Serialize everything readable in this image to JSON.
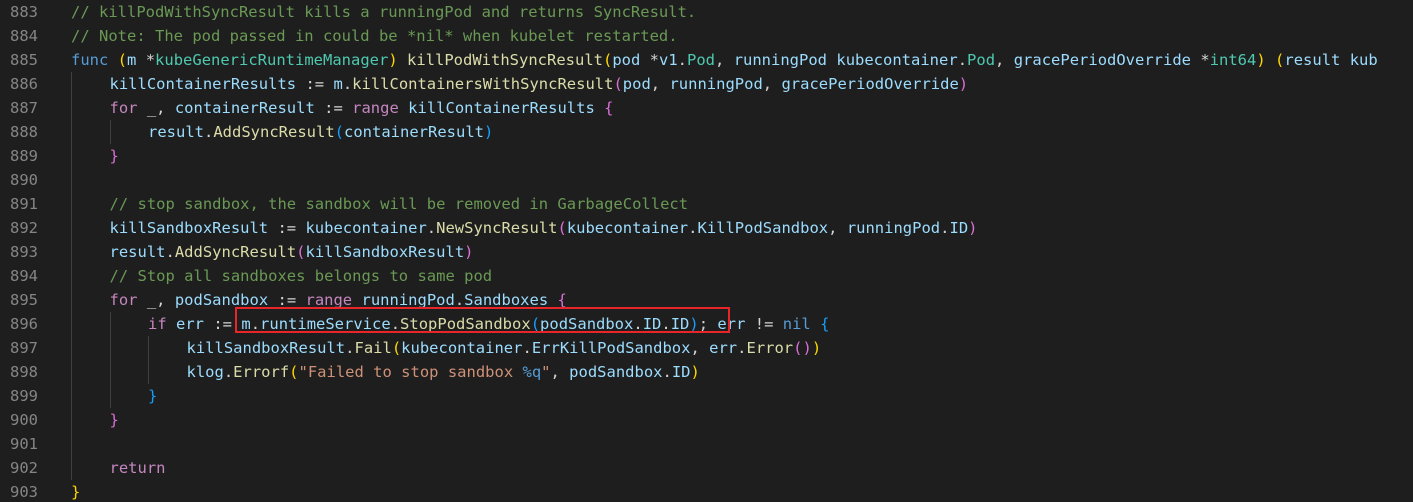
{
  "editor": {
    "language": "go",
    "background": "#1e1e1e",
    "colors": {
      "comment": "#6a9955",
      "keyword": "#569cd6",
      "control": "#c586c0",
      "function": "#dcdcaa",
      "variable": "#9cdcfe",
      "type": "#4ec9b0",
      "string": "#ce9178",
      "bracket_level_1": "#ffd700",
      "bracket_level_2": "#da70d6",
      "bracket_level_3": "#179fff",
      "line_number": "#858585",
      "highlight_box": "#e8262a"
    },
    "highlighted_line": 896,
    "highlighted_text": "m.runtimeService.StopPodSandbox(podSandbox.ID.ID);",
    "lines": [
      {
        "num": "883",
        "indent": 0,
        "tokens": [
          {
            "t": "// killPodWithSyncResult kills a runningPod and returns SyncResult.",
            "c": "cm"
          }
        ]
      },
      {
        "num": "884",
        "indent": 0,
        "tokens": [
          {
            "t": "// Note: The pod passed in could be *nil* when kubelet restarted.",
            "c": "cm"
          }
        ]
      },
      {
        "num": "885",
        "indent": 0,
        "tokens": [
          {
            "t": "func",
            "c": "kw"
          },
          {
            "t": " ",
            "c": "pl"
          },
          {
            "t": "(",
            "c": "b1"
          },
          {
            "t": "m",
            "c": "vr"
          },
          {
            "t": " *",
            "c": "pl"
          },
          {
            "t": "kubeGenericRuntimeManager",
            "c": "ty"
          },
          {
            "t": ")",
            "c": "b1"
          },
          {
            "t": " ",
            "c": "pl"
          },
          {
            "t": "killPodWithSyncResult",
            "c": "fn"
          },
          {
            "t": "(",
            "c": "b1"
          },
          {
            "t": "pod",
            "c": "vr"
          },
          {
            "t": " *",
            "c": "pl"
          },
          {
            "t": "v1",
            "c": "vr"
          },
          {
            "t": ".",
            "c": "pl"
          },
          {
            "t": "Pod",
            "c": "ty"
          },
          {
            "t": ", ",
            "c": "pl"
          },
          {
            "t": "runningPod",
            "c": "vr"
          },
          {
            "t": " ",
            "c": "pl"
          },
          {
            "t": "kubecontainer",
            "c": "vr"
          },
          {
            "t": ".",
            "c": "pl"
          },
          {
            "t": "Pod",
            "c": "ty"
          },
          {
            "t": ", ",
            "c": "pl"
          },
          {
            "t": "gracePeriodOverride",
            "c": "vr"
          },
          {
            "t": " *",
            "c": "pl"
          },
          {
            "t": "int64",
            "c": "ty"
          },
          {
            "t": ")",
            "c": "b1"
          },
          {
            "t": " ",
            "c": "pl"
          },
          {
            "t": "(",
            "c": "b1"
          },
          {
            "t": "result",
            "c": "vr"
          },
          {
            "t": " kub",
            "c": "vr"
          }
        ]
      },
      {
        "num": "886",
        "indent": 1,
        "tokens": [
          {
            "t": "killContainerResults",
            "c": "vr"
          },
          {
            "t": " := ",
            "c": "pl"
          },
          {
            "t": "m",
            "c": "vr"
          },
          {
            "t": ".",
            "c": "pl"
          },
          {
            "t": "killContainersWithSyncResult",
            "c": "fn"
          },
          {
            "t": "(",
            "c": "b2"
          },
          {
            "t": "pod",
            "c": "vr"
          },
          {
            "t": ", ",
            "c": "pl"
          },
          {
            "t": "runningPod",
            "c": "vr"
          },
          {
            "t": ", ",
            "c": "pl"
          },
          {
            "t": "gracePeriodOverride",
            "c": "vr"
          },
          {
            "t": ")",
            "c": "b2"
          }
        ]
      },
      {
        "num": "887",
        "indent": 1,
        "tokens": [
          {
            "t": "for",
            "c": "kc"
          },
          {
            "t": " _, ",
            "c": "pl"
          },
          {
            "t": "containerResult",
            "c": "vr"
          },
          {
            "t": " := ",
            "c": "pl"
          },
          {
            "t": "range",
            "c": "kc"
          },
          {
            "t": " ",
            "c": "pl"
          },
          {
            "t": "killContainerResults",
            "c": "vr"
          },
          {
            "t": " ",
            "c": "pl"
          },
          {
            "t": "{",
            "c": "b2"
          }
        ]
      },
      {
        "num": "888",
        "indent": 2,
        "tokens": [
          {
            "t": "result",
            "c": "vr"
          },
          {
            "t": ".",
            "c": "pl"
          },
          {
            "t": "AddSyncResult",
            "c": "fn"
          },
          {
            "t": "(",
            "c": "b3"
          },
          {
            "t": "containerResult",
            "c": "vr"
          },
          {
            "t": ")",
            "c": "b3"
          }
        ]
      },
      {
        "num": "889",
        "indent": 1,
        "tokens": [
          {
            "t": "}",
            "c": "b2"
          }
        ]
      },
      {
        "num": "890",
        "indent": 0,
        "tokens": []
      },
      {
        "num": "891",
        "indent": 1,
        "tokens": [
          {
            "t": "// stop sandbox, the sandbox will be removed in GarbageCollect",
            "c": "cm"
          }
        ]
      },
      {
        "num": "892",
        "indent": 1,
        "tokens": [
          {
            "t": "killSandboxResult",
            "c": "vr"
          },
          {
            "t": " := ",
            "c": "pl"
          },
          {
            "t": "kubecontainer",
            "c": "vr"
          },
          {
            "t": ".",
            "c": "pl"
          },
          {
            "t": "NewSyncResult",
            "c": "fn"
          },
          {
            "t": "(",
            "c": "b2"
          },
          {
            "t": "kubecontainer",
            "c": "vr"
          },
          {
            "t": ".",
            "c": "pl"
          },
          {
            "t": "KillPodSandbox",
            "c": "vr"
          },
          {
            "t": ", ",
            "c": "pl"
          },
          {
            "t": "runningPod",
            "c": "vr"
          },
          {
            "t": ".",
            "c": "pl"
          },
          {
            "t": "ID",
            "c": "vr"
          },
          {
            "t": ")",
            "c": "b2"
          }
        ]
      },
      {
        "num": "893",
        "indent": 1,
        "tokens": [
          {
            "t": "result",
            "c": "vr"
          },
          {
            "t": ".",
            "c": "pl"
          },
          {
            "t": "AddSyncResult",
            "c": "fn"
          },
          {
            "t": "(",
            "c": "b2"
          },
          {
            "t": "killSandboxResult",
            "c": "vr"
          },
          {
            "t": ")",
            "c": "b2"
          }
        ]
      },
      {
        "num": "894",
        "indent": 1,
        "tokens": [
          {
            "t": "// Stop all sandboxes belongs to same pod",
            "c": "cm"
          }
        ]
      },
      {
        "num": "895",
        "indent": 1,
        "tokens": [
          {
            "t": "for",
            "c": "kc"
          },
          {
            "t": " _, ",
            "c": "pl"
          },
          {
            "t": "podSandbox",
            "c": "vr"
          },
          {
            "t": " := ",
            "c": "pl"
          },
          {
            "t": "range",
            "c": "kc"
          },
          {
            "t": " ",
            "c": "pl"
          },
          {
            "t": "runningPod",
            "c": "vr"
          },
          {
            "t": ".",
            "c": "pl"
          },
          {
            "t": "Sandboxes",
            "c": "vr"
          },
          {
            "t": " ",
            "c": "pl"
          },
          {
            "t": "{",
            "c": "b2"
          }
        ]
      },
      {
        "num": "896",
        "indent": 2,
        "tokens": [
          {
            "t": "if",
            "c": "kc"
          },
          {
            "t": " ",
            "c": "pl"
          },
          {
            "t": "err",
            "c": "vr"
          },
          {
            "t": " := ",
            "c": "pl"
          },
          {
            "t": "m",
            "c": "vr"
          },
          {
            "t": ".",
            "c": "pl"
          },
          {
            "t": "runtimeService",
            "c": "vr"
          },
          {
            "t": ".",
            "c": "pl"
          },
          {
            "t": "StopPodSandbox",
            "c": "fn"
          },
          {
            "t": "(",
            "c": "b3"
          },
          {
            "t": "podSandbox",
            "c": "vr"
          },
          {
            "t": ".",
            "c": "pl"
          },
          {
            "t": "ID",
            "c": "vr"
          },
          {
            "t": ".",
            "c": "pl"
          },
          {
            "t": "ID",
            "c": "vr"
          },
          {
            "t": ")",
            "c": "b3"
          },
          {
            "t": "; ",
            "c": "pl"
          },
          {
            "t": "err",
            "c": "vr"
          },
          {
            "t": " != ",
            "c": "pl"
          },
          {
            "t": "nil",
            "c": "kw"
          },
          {
            "t": " ",
            "c": "pl"
          },
          {
            "t": "{",
            "c": "b3"
          }
        ]
      },
      {
        "num": "897",
        "indent": 3,
        "tokens": [
          {
            "t": "killSandboxResult",
            "c": "vr"
          },
          {
            "t": ".",
            "c": "pl"
          },
          {
            "t": "Fail",
            "c": "fn"
          },
          {
            "t": "(",
            "c": "b1"
          },
          {
            "t": "kubecontainer",
            "c": "vr"
          },
          {
            "t": ".",
            "c": "pl"
          },
          {
            "t": "ErrKillPodSandbox",
            "c": "vr"
          },
          {
            "t": ", ",
            "c": "pl"
          },
          {
            "t": "err",
            "c": "vr"
          },
          {
            "t": ".",
            "c": "pl"
          },
          {
            "t": "Error",
            "c": "fn"
          },
          {
            "t": "(",
            "c": "b2"
          },
          {
            "t": ")",
            "c": "b2"
          },
          {
            "t": ")",
            "c": "b1"
          }
        ]
      },
      {
        "num": "898",
        "indent": 3,
        "tokens": [
          {
            "t": "klog",
            "c": "vr"
          },
          {
            "t": ".",
            "c": "pl"
          },
          {
            "t": "Errorf",
            "c": "fn"
          },
          {
            "t": "(",
            "c": "b1"
          },
          {
            "t": "\"Failed to stop sandbox ",
            "c": "st"
          },
          {
            "t": "%q",
            "c": "kw"
          },
          {
            "t": "\"",
            "c": "st"
          },
          {
            "t": ", ",
            "c": "pl"
          },
          {
            "t": "podSandbox",
            "c": "vr"
          },
          {
            "t": ".",
            "c": "pl"
          },
          {
            "t": "ID",
            "c": "vr"
          },
          {
            "t": ")",
            "c": "b1"
          }
        ]
      },
      {
        "num": "899",
        "indent": 2,
        "tokens": [
          {
            "t": "}",
            "c": "b3"
          }
        ]
      },
      {
        "num": "900",
        "indent": 1,
        "tokens": [
          {
            "t": "}",
            "c": "b2"
          }
        ]
      },
      {
        "num": "901",
        "indent": 0,
        "tokens": []
      },
      {
        "num": "902",
        "indent": 1,
        "tokens": [
          {
            "t": "return",
            "c": "kc"
          }
        ]
      },
      {
        "num": "903",
        "indent": 0,
        "tokens": [
          {
            "t": "}",
            "c": "b1"
          }
        ]
      }
    ]
  }
}
